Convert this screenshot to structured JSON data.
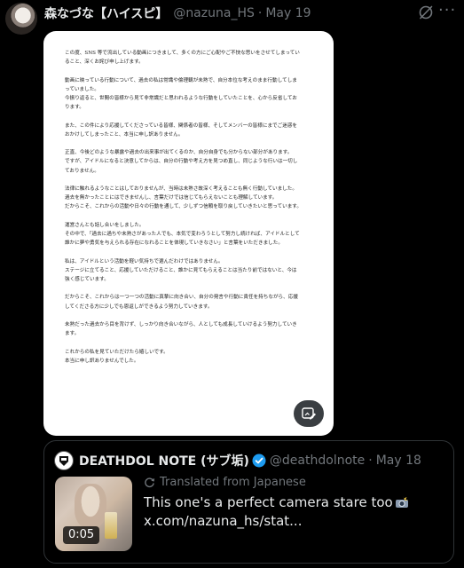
{
  "post": {
    "display_name": "森なづな【ハイスピ】",
    "handle": "@nazuna_HS",
    "separator": "·",
    "date": "May 19",
    "more_label": "···",
    "icons": [
      "avatar",
      "grok-icon",
      "more-icon",
      "alt-text-edit-icon"
    ]
  },
  "document": {
    "paragraphs": [
      [
        "この度、SNS 等で流出している動画につきまして、多くの方にご心配やご不快な思いをさせてしまってい",
        "ること、深くお詫び申し上げます。"
      ],
      [
        "動画に映っている行動について、過去の私は常識や倫理観が未熟で、自分本位な考えのまま行動してしま",
        "っていました。",
        "今振り返ると、世間の皆様から見て非常識だと思われるような行動をしていたことを、心から反省してお",
        "ります。"
      ],
      [
        "また、この件により応援してくださっている皆様、関係者の皆様、そしてメンバーの皆様にまでご迷惑を",
        "おかけしてしまったこと、本当に申し訳ありません。"
      ],
      [
        "正直、今後どのような暴露や過去の出来事が出てくるのか、自分自身でも分からない部分があります。",
        "ですが、アイドルになると決意してからは、自分の行動や考え方を見つめ直し、同じような行いは一切し",
        "ておりません。"
      ],
      [
        "法律に触れるようなことはしておりませんが、当時は未熟さ故深く考えることも無く行動していました。",
        "過去を無かったことにはできませんし、言葉だけでは信じてもらえないことも理解しています。",
        "だからこそ、これからの活動や日々の行動を通して、少しずつ信頼を取り戻していきたいと思っています。"
      ],
      [
        "運営さんとも話し合いをしました。",
        "その中で、「過去に過ちや未熟さがあった人でも、本気で変わろうとして努力し続ければ、アイドルとして",
        "誰かに夢や勇気を与えられる存在になれることを体現していきなさい」と言葉をいただきました。"
      ],
      [
        "私は、アイドルという活動を軽い気持ちで選んだわけではありません。",
        "ステージに立てること、応援していただけること、誰かに見てもらえることは当たり前ではないと、今は",
        "強く感じています。"
      ],
      [
        "だからこそ、これからは一つ一つの活動に真摯に向き合い、自分の発言や行動に責任を持ちながら、応援",
        "してくださる方に少しでも恩返しができるよう努力していきます。"
      ],
      [
        "未熟だった過去から目を背けず、しっかり向き合いながら、人としても成長していけるよう努力していき",
        "ます。"
      ],
      [
        "これからの私を見ていただけたら嬉しいです。",
        "本当に申し訳ありませんでした。"
      ]
    ]
  },
  "quote": {
    "display_name": "DEATHDOL NOTE (サブ垢)",
    "handle": "@deathdolnote",
    "separator": "·",
    "date": "May 18",
    "translated_label": "Translated from Japanese",
    "text_line1": "This one's a perfect camera stare too",
    "text_line2": "x.com/nazuna_hs/stat...",
    "video_duration": "0:05",
    "icons": [
      "verified-badge-icon",
      "translate-icon",
      "camera-flash-emoji"
    ]
  },
  "colors": {
    "background": "#000000",
    "primary_text": "#e7e9ea",
    "secondary_text": "#71767b",
    "border": "#2f3336",
    "verified_blue": "#1d9bf0"
  }
}
